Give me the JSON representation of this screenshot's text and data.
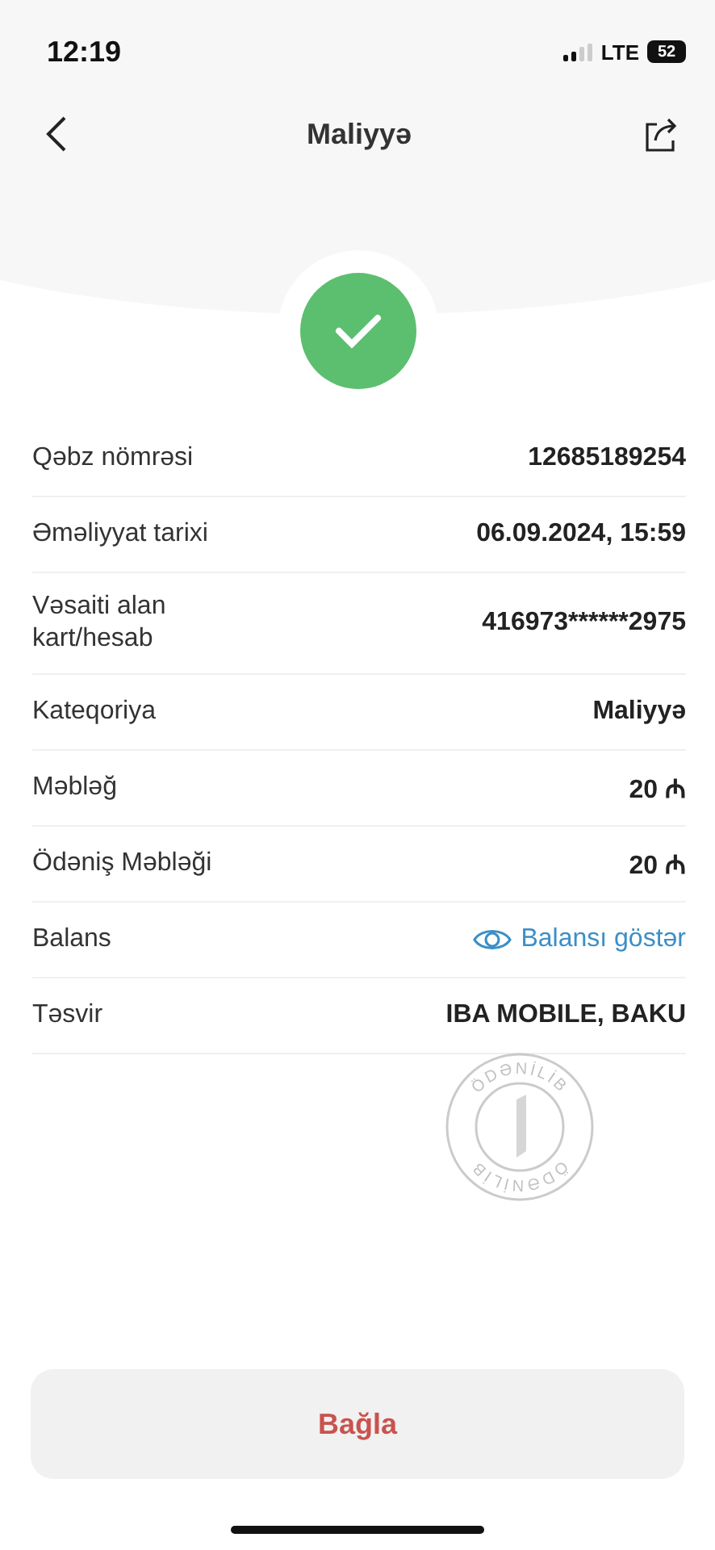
{
  "status_bar": {
    "time": "12:19",
    "network": "LTE",
    "battery": "52"
  },
  "header": {
    "title": "Maliyyə"
  },
  "status": {
    "kind": "success"
  },
  "rows": [
    {
      "label": "Qəbz nömrəsi",
      "value": "12685189254",
      "kind": "text"
    },
    {
      "label": "Əməliyyat tarixi",
      "value": "06.09.2024, 15:59",
      "kind": "text"
    },
    {
      "label": "Vəsaiti alan kart/hesab",
      "value": "416973******2975",
      "kind": "text"
    },
    {
      "label": "Kateqoriya",
      "value": "Maliyyə",
      "kind": "text"
    },
    {
      "label": "Məbləğ",
      "value": "20 ₼",
      "kind": "text"
    },
    {
      "label": "Ödəniş Məbləği",
      "value": "20 ₼",
      "kind": "text"
    },
    {
      "label": "Balans",
      "value": "Balansı göstər",
      "kind": "link"
    },
    {
      "label": "Təsvir",
      "value": "IBA MOBILE, BAKU",
      "kind": "text"
    }
  ],
  "stamp": {
    "texts": [
      "ÖDƏNİLİB",
      "ÖDƏNİLİB"
    ]
  },
  "close_button": {
    "label": "Bağla"
  }
}
